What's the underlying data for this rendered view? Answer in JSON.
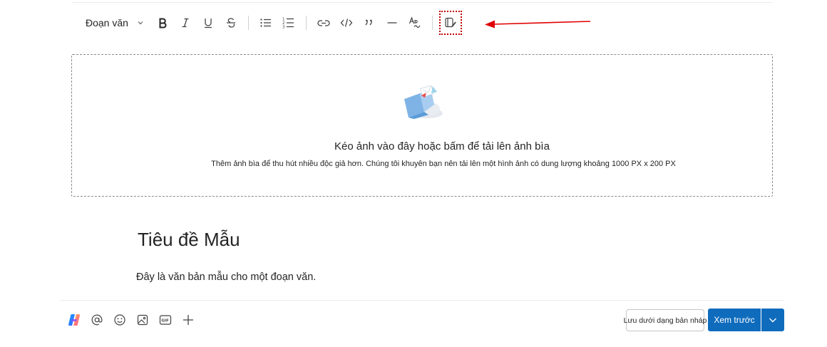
{
  "toolbar": {
    "paragraph_style": "Đoạn văn",
    "buttons": [
      {
        "icon": "bold-icon"
      },
      {
        "icon": "italic-icon"
      },
      {
        "icon": "underline-icon"
      },
      {
        "icon": "strikethrough-icon"
      },
      {
        "icon": "bulleted-list-icon"
      },
      {
        "icon": "numbered-list-icon"
      },
      {
        "icon": "link-icon"
      },
      {
        "icon": "code-icon"
      },
      {
        "icon": "quote-icon"
      },
      {
        "icon": "horizontal-rule-icon"
      },
      {
        "icon": "spelling-icon"
      },
      {
        "icon": "edit-note-icon"
      }
    ]
  },
  "annotation": {
    "arrow_color": "#e00000"
  },
  "upload": {
    "title": "Kéo ảnh vào đây hoặc bấm để tải lên ảnh bìa",
    "subtitle": "Thêm ảnh bìa để thu hút nhiều độc giả hơn. Chúng tôi khuyên bạn nên tải lên một hình ảnh có dung lượng khoảng 1000 PX x 200 PX",
    "art_icon": "cloud-upload-illustration-icon"
  },
  "content": {
    "title": "Tiêu đề Mẫu",
    "paragraph": "Đây là văn bản mẫu cho một đoạn văn."
  },
  "bottom_bar": {
    "icons": [
      "copilot-icon",
      "mention-icon",
      "emoji-icon",
      "image-icon",
      "gif-icon",
      "add-icon"
    ],
    "save_draft_label": "Lưu dưới dạng bản nháp",
    "preview_label": "Xem trước"
  },
  "colors": {
    "primary": "#0f6cbd",
    "text": "#242424"
  }
}
